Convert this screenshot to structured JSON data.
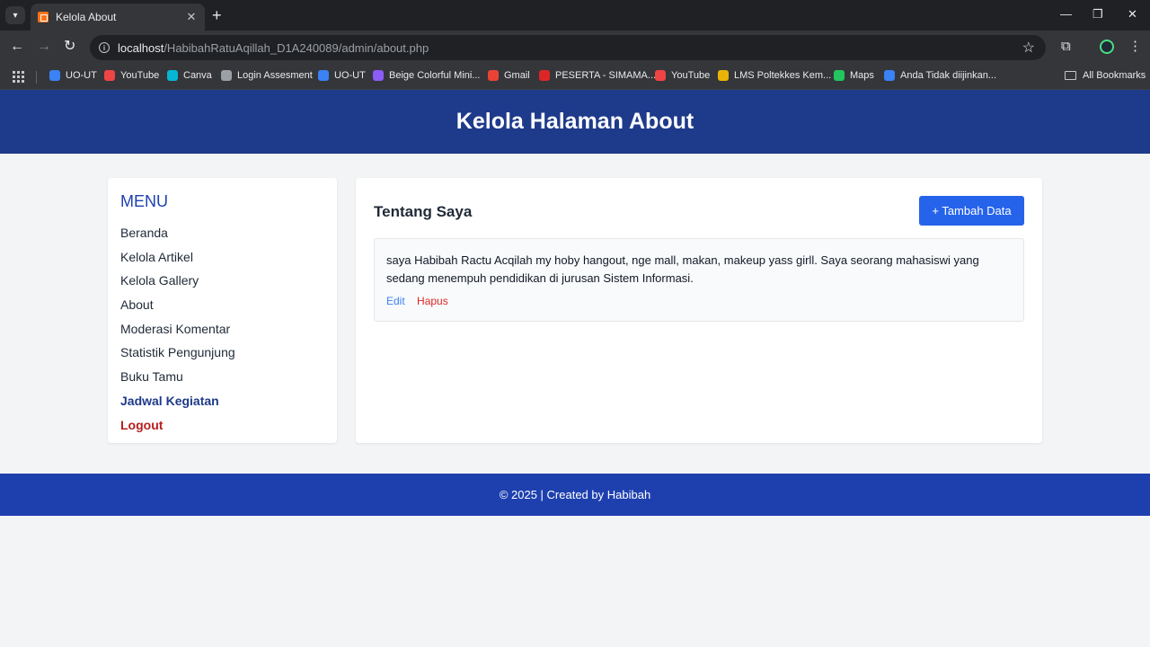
{
  "browser": {
    "tab_title": "Kelola About",
    "url_host": "localhost",
    "url_path": "/HabibahRatuAqillah_D1A240089/admin/about.php",
    "bookmarks": [
      {
        "label": "UO-UT",
        "icon": "uo-ut-icon",
        "color": "#3b82f6"
      },
      {
        "label": "YouTube",
        "icon": "youtube-icon",
        "color": "#ef4444"
      },
      {
        "label": "Canva",
        "icon": "canva-icon",
        "color": "#06b6d4"
      },
      {
        "label": "Login Assesment",
        "icon": "globe-icon",
        "color": "#9aa0a6"
      },
      {
        "label": "UO-UT",
        "icon": "uo-ut-icon",
        "color": "#3b82f6"
      },
      {
        "label": "Beige Colorful Mini...",
        "icon": "canva-icon",
        "color": "#8b5cf6"
      },
      {
        "label": "Gmail",
        "icon": "gmail-icon",
        "color": "#ea4335"
      },
      {
        "label": "PESERTA - SIMAMA...",
        "icon": "simama-icon",
        "color": "#dc2626"
      },
      {
        "label": "YouTube",
        "icon": "youtube-icon",
        "color": "#ef4444"
      },
      {
        "label": "LMS Poltekkes Kem...",
        "icon": "lms-icon",
        "color": "#eab308"
      },
      {
        "label": "Maps",
        "icon": "maps-icon",
        "color": "#22c55e"
      },
      {
        "label": "Anda Tidak diijinkan...",
        "icon": "edu-icon",
        "color": "#3b82f6"
      }
    ],
    "all_bookmarks": "All Bookmarks"
  },
  "header": {
    "title": "Kelola Halaman About"
  },
  "sidebar": {
    "title": "MENU",
    "items": [
      {
        "label": "Beranda"
      },
      {
        "label": "Kelola Artikel"
      },
      {
        "label": "Kelola Gallery"
      },
      {
        "label": "About"
      },
      {
        "label": "Moderasi Komentar"
      },
      {
        "label": "Statistik Pengunjung"
      },
      {
        "label": "Buku Tamu"
      },
      {
        "label": "Jadwal Kegiatan"
      },
      {
        "label": "Logout"
      }
    ]
  },
  "main": {
    "title": "Tentang Saya",
    "add_button": "+ Tambah Data",
    "about_text": "saya Habibah Ractu Acqilah my hoby hangout, nge mall, makan, makeup yass girll. Saya seorang mahasiswi yang sedang menempuh pendidikan di jurusan Sistem Informasi.",
    "edit_label": "Edit",
    "delete_label": "Hapus"
  },
  "footer": {
    "text": "© 2025 | Created by Habibah"
  }
}
